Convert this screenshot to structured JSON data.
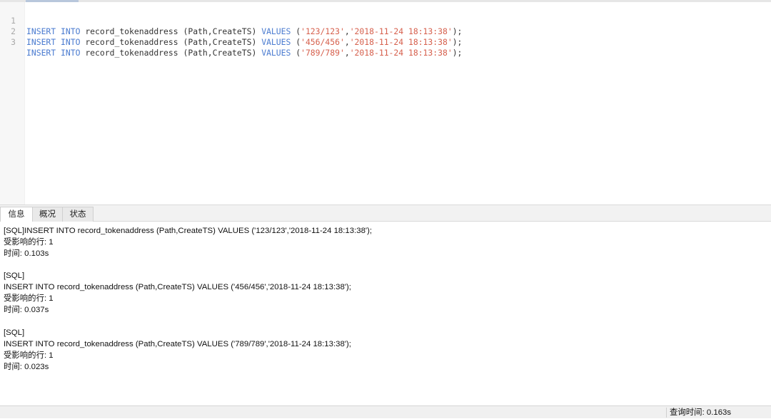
{
  "editor": {
    "lines": [
      {
        "number": "1",
        "kw1": "INSERT",
        "kw2": "INTO",
        "table": "record_tokenaddress",
        "columns": "(Path,CreateTS)",
        "kw3": "VALUES",
        "open": "(",
        "val1": "'123/123'",
        "comma": ",",
        "val2": "'2018-11-24 18:13:38'",
        "close": ");"
      },
      {
        "number": "2",
        "kw1": "INSERT",
        "kw2": "INTO",
        "table": "record_tokenaddress",
        "columns": "(Path,CreateTS)",
        "kw3": "VALUES",
        "open": "(",
        "val1": "'456/456'",
        "comma": ",",
        "val2": "'2018-11-24 18:13:38'",
        "close": ");"
      },
      {
        "number": "3",
        "kw1": "INSERT",
        "kw2": "INTO",
        "table": "record_tokenaddress",
        "columns": "(Path,CreateTS)",
        "kw3": "VALUES",
        "open": "(",
        "val1": "'789/789'",
        "comma": ",",
        "val2": "'2018-11-24 18:13:38'",
        "close": ");"
      }
    ]
  },
  "tabs": [
    {
      "label": "信息",
      "active": true
    },
    {
      "label": "概况",
      "active": false
    },
    {
      "label": "状态",
      "active": false
    }
  ],
  "messages": [
    "[SQL]INSERT INTO record_tokenaddress (Path,CreateTS) VALUES ('123/123','2018-11-24 18:13:38');",
    "受影响的行: 1",
    "时间: 0.103s",
    "",
    "[SQL]",
    "INSERT INTO record_tokenaddress (Path,CreateTS) VALUES ('456/456','2018-11-24 18:13:38');",
    "受影响的行: 1",
    "时间: 0.037s",
    "",
    "[SQL]",
    "INSERT INTO record_tokenaddress (Path,CreateTS) VALUES ('789/789','2018-11-24 18:13:38');",
    "受影响的行: 1",
    "时间: 0.023s"
  ],
  "status": {
    "query_time": "查询时间: 0.163s"
  },
  "colors": {
    "keyword": "#4a7bd0",
    "string": "#d6604d",
    "line_number": "#a9a9a9"
  }
}
